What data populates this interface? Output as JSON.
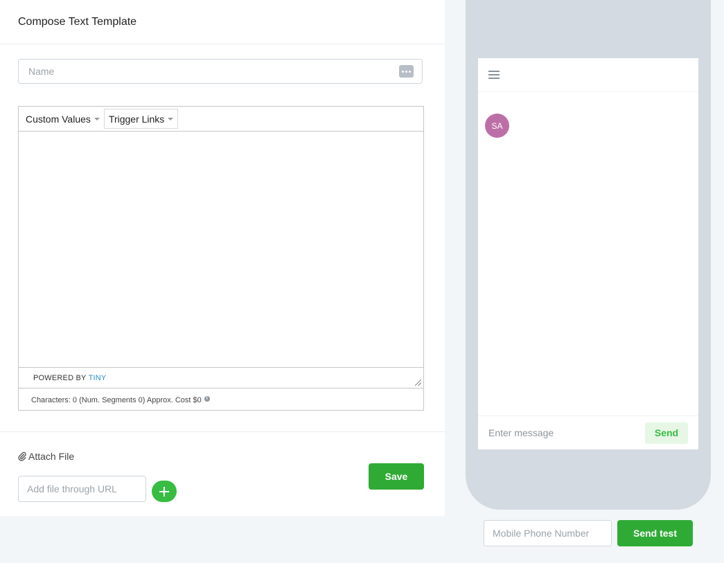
{
  "header": {
    "title": "Compose Text Template"
  },
  "form": {
    "name_placeholder": "Name",
    "name_value": "",
    "name_icon": "ellipsis-icon"
  },
  "editor": {
    "toolbar": {
      "custom_values_label": "Custom Values",
      "trigger_links_label": "Trigger Links"
    },
    "content": "",
    "powered_by_prefix": "POWERED BY",
    "powered_by_brand": "TINY",
    "stats": "Characters: 0 (Num. Segments 0) Approx. Cost $0",
    "info_icon": "info-icon"
  },
  "attach": {
    "label": "Attach File",
    "url_placeholder": "Add file through URL",
    "add_icon": "plus-icon"
  },
  "actions": {
    "save_label": "Save"
  },
  "preview": {
    "menu_icon": "hamburger-menu-icon",
    "avatar_initials": "SA",
    "message_placeholder": "Enter message",
    "send_label": "Send"
  },
  "test": {
    "phone_placeholder": "Mobile Phone Number",
    "send_test_label": "Send test"
  },
  "colors": {
    "primary_green": "#2fab35",
    "avatar": "#bc6fa7",
    "tiny_link": "#2e8cc8",
    "phone_frame": "#d3dae1"
  }
}
